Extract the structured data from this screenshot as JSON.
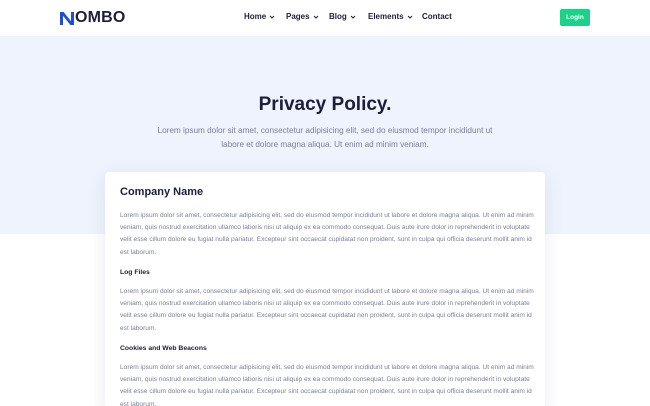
{
  "header": {
    "logo_text": "OMBO",
    "nav": [
      {
        "label": "Home",
        "has_dropdown": true
      },
      {
        "label": "Pages",
        "has_dropdown": true
      },
      {
        "label": "Blog",
        "has_dropdown": true
      },
      {
        "label": "Elements",
        "has_dropdown": true
      },
      {
        "label": "Contact",
        "has_dropdown": false
      }
    ],
    "login_label": "Login"
  },
  "hero": {
    "title": "Privacy Policy.",
    "text": "Lorem ipsum dolor sit amet, consectetur adipisicing elit, sed do eiusmod tempor incididunt ut labore et dolore magna aliqua. Ut enim ad minim veniam."
  },
  "content": {
    "heading": "Company Name",
    "sections": [
      {
        "title": "",
        "text": "Lorem ipsum dolor sit amet, consectetur adipisicing elit, sed do eiusmod tempor incididunt ut labore et dolore magna aliqua. Ut enim ad minim veniam, quis nostrud exercitation ullamco laboris nisi ut aliquip ex ea commodo consequat. Duis aute irure dolor in reprehenderit in voluptate velit esse cillum dolore eu fugiat nulla pariatur. Excepteur sint occaecat cupidatat non proident, sunt in culpa qui officia deserunt mollit anim id est laborum."
      },
      {
        "title": "Log Files",
        "text": "Lorem ipsum dolor sit amet, consectetur adipisicing elit, sed do eiusmod tempor incididunt ut labore et dolore magna aliqua. Ut enim ad minim veniam, quis nostrud exercitation ullamco laboris nisi ut aliquip ex ea commodo consequat. Duis aute irure dolor in reprehenderit in voluptate velit esse cillum dolore eu fugiat nulla pariatur. Excepteur sint occaecat cupidatat non proident, sunt in culpa qui officia deserunt mollit anim id est laborum."
      },
      {
        "title": "Cookies and Web Beacons",
        "text": "Lorem ipsum dolor sit amet, consectetur adipisicing elit, sed do eiusmod tempor incididunt ut labore et dolore magna aliqua. Ut enim ad minim veniam, quis nostrud exercitation ullamco laboris nisi ut aliquip ex ea commodo consequat. Duis aute irure dolor in reprehenderit in voluptate velit esse cillum dolore eu fugiat nulla pariatur. Excepteur sint occaecat cupidatat non proident, sunt in culpa qui officia deserunt mollit anim id est laborum."
      }
    ]
  },
  "colors": {
    "accent": "#1d4ed8",
    "login_button": "#1dd18b",
    "hero_background": "#eef3fd",
    "heading": "#1b1f3b",
    "body_text": "#7a7f99"
  },
  "icons": [
    "logo-icon",
    "chevron-down-icon"
  ]
}
